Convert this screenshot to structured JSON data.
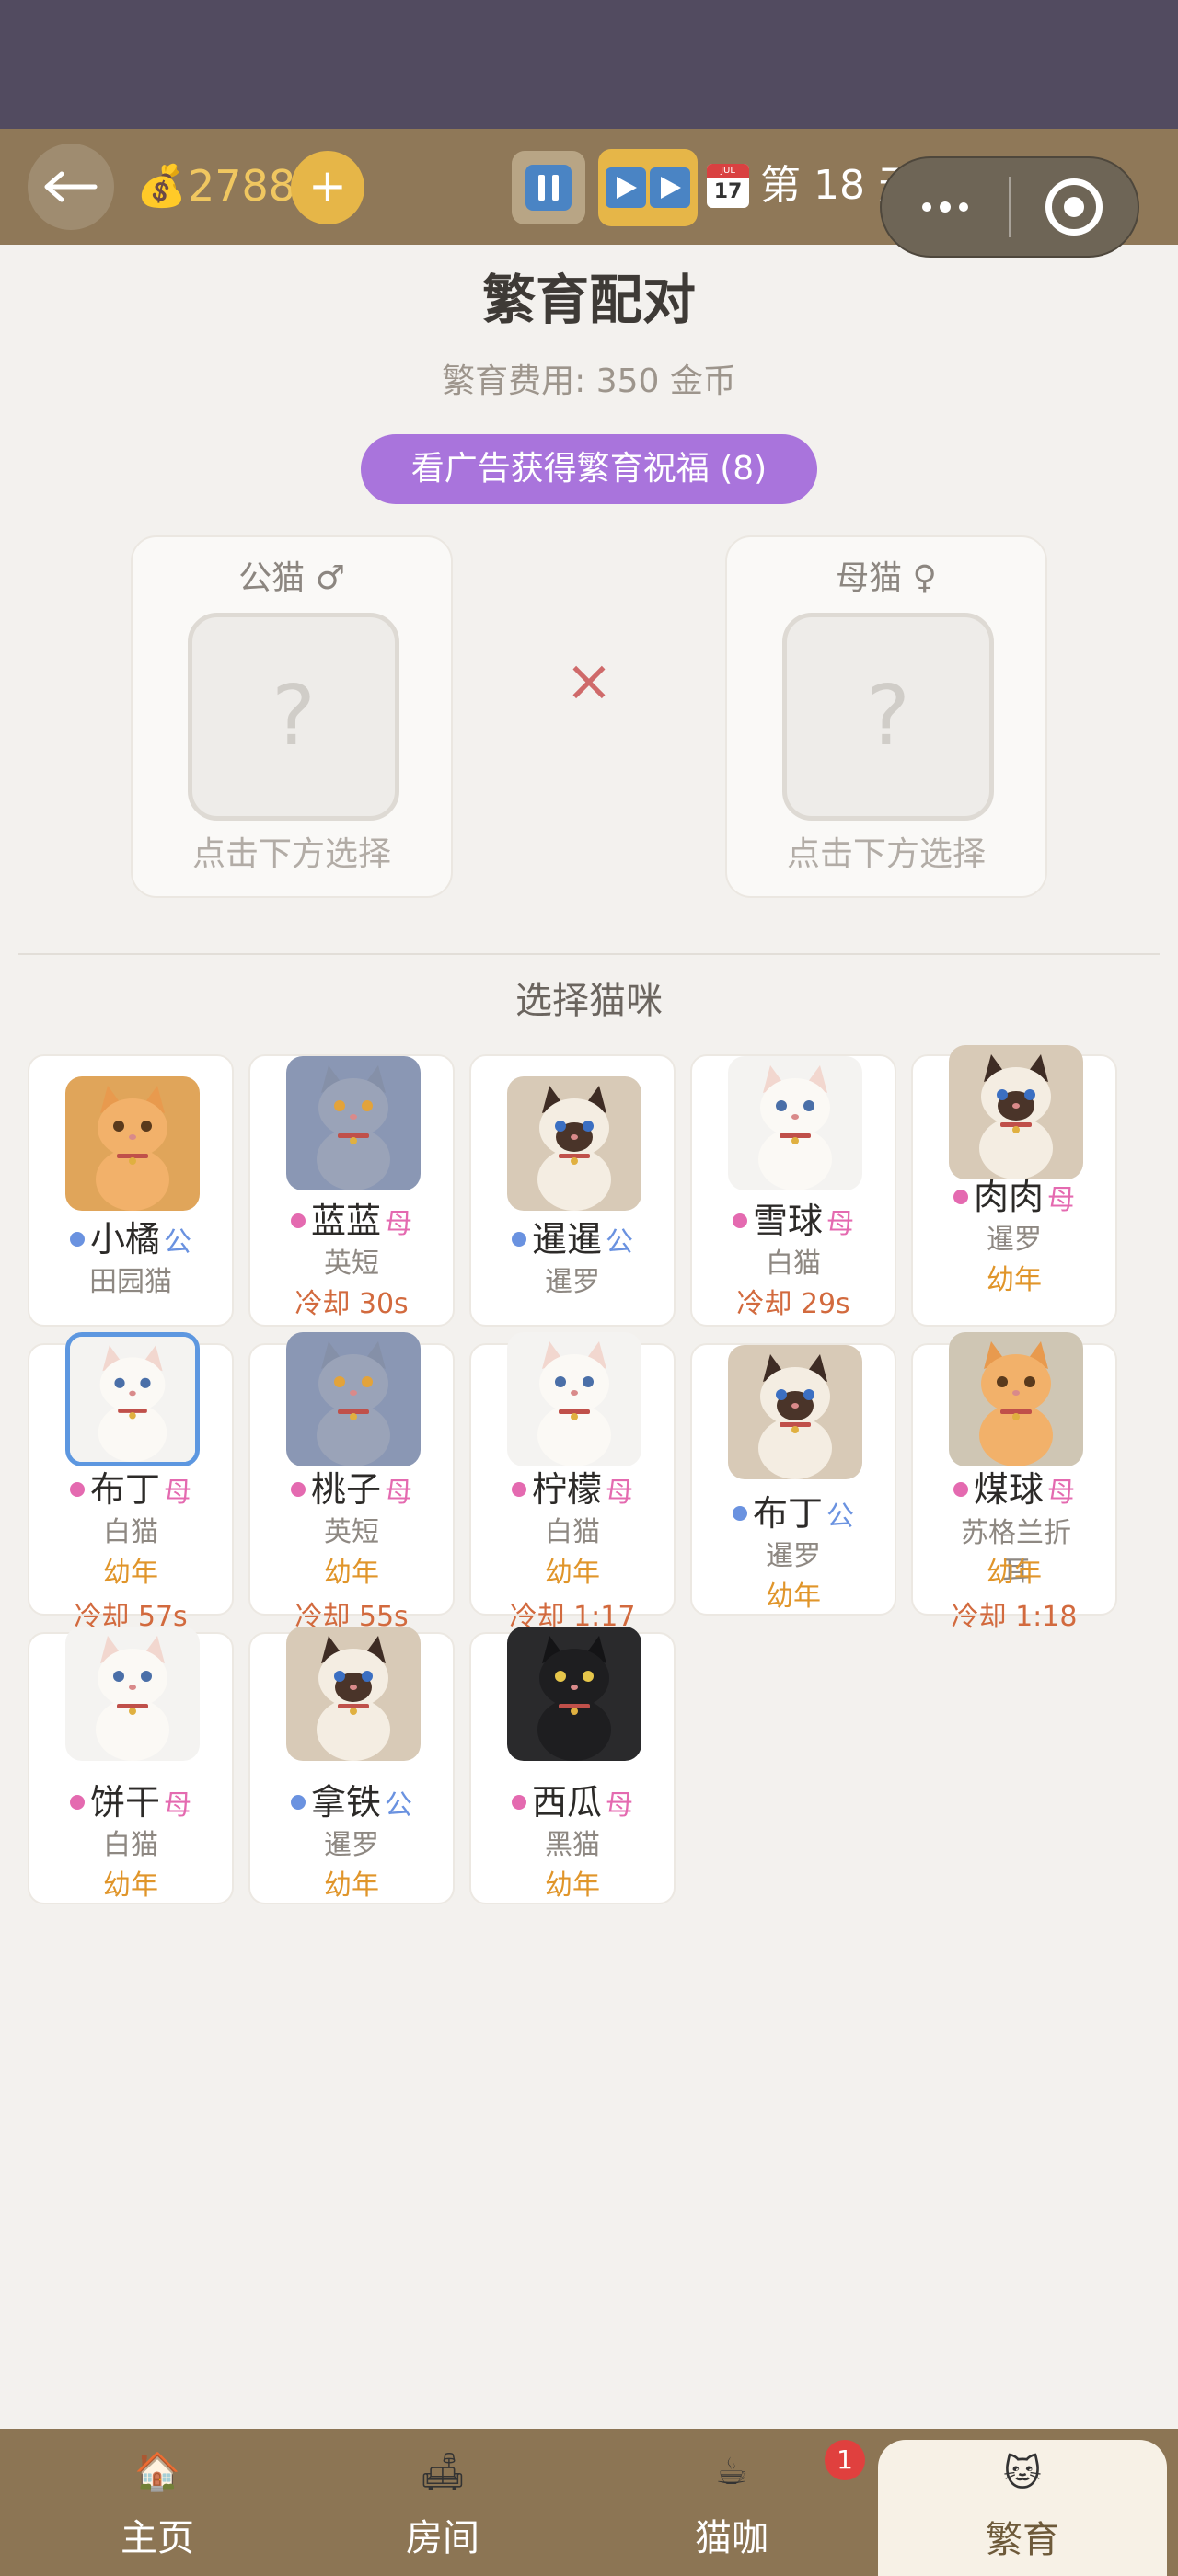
{
  "header": {
    "coins": "2788",
    "add_label": "+",
    "calendar_month": "JUL",
    "calendar_day": "17",
    "day_label": "第 18 天"
  },
  "breeding": {
    "title": "繁育配对",
    "fee": "繁育费用: 350 金币",
    "ad_button": "看广告获得繁育祝福 (8)",
    "male_slot_label": "公猫 ♂",
    "female_slot_label": "母猫 ♀",
    "slot_placeholder": "?",
    "slot_hint": "点击下方选择",
    "cross_symbol": "×"
  },
  "selector": {
    "title": "选择猫咪",
    "cats": [
      {
        "name": "小橘",
        "gender": "公",
        "gender_code": "m",
        "breed": "田园猫",
        "age": "",
        "cooldown": "",
        "coat": "orange",
        "bg": "#e0a55a"
      },
      {
        "name": "蓝蓝",
        "gender": "母",
        "gender_code": "f",
        "breed": "英短",
        "age": "",
        "cooldown": "冷却 30s",
        "coat": "gray",
        "bg": "#8a97b4"
      },
      {
        "name": "暹暹",
        "gender": "公",
        "gender_code": "m",
        "breed": "暹罗",
        "age": "",
        "cooldown": "",
        "coat": "siamese",
        "bg": "#d8cab7"
      },
      {
        "name": "雪球",
        "gender": "母",
        "gender_code": "f",
        "breed": "白猫",
        "age": "",
        "cooldown": "冷却 29s",
        "coat": "white",
        "bg": "#f4f3f1"
      },
      {
        "name": "肉肉",
        "gender": "母",
        "gender_code": "f",
        "breed": "暹罗",
        "age": "幼年",
        "cooldown": "",
        "coat": "siamese",
        "bg": "#d8cab7"
      },
      {
        "name": "布丁",
        "gender": "母",
        "gender_code": "f",
        "breed": "白猫",
        "age": "幼年",
        "cooldown": "冷却 57s",
        "coat": "white",
        "bg": "#f4f3f1",
        "selected": true
      },
      {
        "name": "桃子",
        "gender": "母",
        "gender_code": "f",
        "breed": "英短",
        "age": "幼年",
        "cooldown": "冷却 55s",
        "coat": "gray",
        "bg": "#8a97b4"
      },
      {
        "name": "柠檬",
        "gender": "母",
        "gender_code": "f",
        "breed": "白猫",
        "age": "幼年",
        "cooldown": "冷却 1:17",
        "coat": "white",
        "bg": "#f4f3f1"
      },
      {
        "name": "布丁",
        "gender": "公",
        "gender_code": "m",
        "breed": "暹罗",
        "age": "幼年",
        "cooldown": "",
        "coat": "siamese",
        "bg": "#d8cab7"
      },
      {
        "name": "煤球",
        "gender": "母",
        "gender_code": "f",
        "breed": "苏格兰折耳",
        "age": "幼年",
        "cooldown": "冷却 1:18",
        "coat": "orange",
        "bg": "#cfc6b4"
      },
      {
        "name": "饼干",
        "gender": "母",
        "gender_code": "f",
        "breed": "白猫",
        "age": "幼年",
        "cooldown": "",
        "coat": "white",
        "bg": "#f4f3f1"
      },
      {
        "name": "拿铁",
        "gender": "公",
        "gender_code": "m",
        "breed": "暹罗",
        "age": "幼年",
        "cooldown": "",
        "coat": "siamese",
        "bg": "#d8cab7"
      },
      {
        "name": "西瓜",
        "gender": "母",
        "gender_code": "f",
        "breed": "黑猫",
        "age": "幼年",
        "cooldown": "",
        "coat": "black",
        "bg": "#2a2a2c"
      }
    ]
  },
  "nav": {
    "items": [
      {
        "label": "主页",
        "icon": "home-icon"
      },
      {
        "label": "房间",
        "icon": "room-icon"
      },
      {
        "label": "猫咖",
        "icon": "cafe-icon"
      },
      {
        "label": "繁育",
        "icon": "breeding-icon"
      }
    ],
    "cafe_badge": "1"
  },
  "colors": {
    "topbar": "#8f7858",
    "accent_purple": "#a974dc",
    "coin_gold": "#e6b648",
    "male_blue": "#6a92e0",
    "female_pink": "#e46ab0",
    "age_orange": "#e0952a"
  }
}
